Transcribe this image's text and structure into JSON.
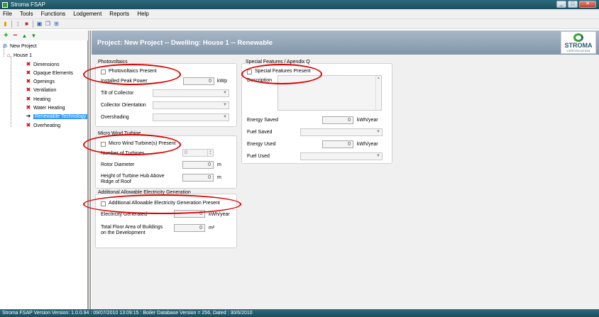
{
  "window": {
    "title": "Stroma FSAP",
    "min": "_",
    "max": "□",
    "close": "✕"
  },
  "menu": [
    "File",
    "Tools",
    "Functions",
    "Lodgement",
    "Reports",
    "Help"
  ],
  "tree": {
    "root": "New Project",
    "house": "House 1",
    "items": [
      "Dimensions",
      "Opaque Elements",
      "Openings",
      "Ventilation",
      "Heating",
      "Water Heating",
      "Renewable Technology",
      "Overheating"
    ],
    "selected_index": 6
  },
  "header": {
    "title": "Project: New Project -- Dwelling: House 1 -- Renewable"
  },
  "logo": {
    "brand": "STROMA",
    "sub": "CERTIFICATION"
  },
  "photovoltaics": {
    "legend": "Photovoltaics",
    "present_label": "Photovoltaics Present",
    "peak_power_label": "Installed Peak Power",
    "peak_power_value": "0",
    "peak_power_unit": "kWp",
    "tilt_label": "Tilt of Collector",
    "orientation_label": "Collector Orientation",
    "overshading_label": "Overshading"
  },
  "wind": {
    "legend": "Micro Wind Turbine",
    "present_label": "Micro Wind Turbine(s) Present",
    "turbines_label": "Number of Turbines",
    "turbines_value": "0",
    "rotor_label": "Rotor Diameter",
    "rotor_value": "0",
    "rotor_unit": "m",
    "hub_label_1": "Height of Turbine Hub Above",
    "hub_label_2": "Ridge of Roof",
    "hub_value": "0",
    "hub_unit": "m"
  },
  "electricity": {
    "legend": "Additional Allowable Electricity Generation",
    "present_label": "Additional Allowable Electricity Generation Present",
    "generated_label": "Electricity Generated",
    "generated_value": "0",
    "generated_unit": "kWh/year",
    "floor_label_1": "Total Floor Area of Buildings",
    "floor_label_2": "on the Development",
    "floor_value": "0",
    "floor_unit": "m²"
  },
  "special": {
    "legend": "Special Features / Apendix Q",
    "present_label": "Special Features Present",
    "description_label": "Description",
    "energy_saved_label": "Energy Saved",
    "energy_saved_value": "0",
    "energy_saved_unit": "kWh/year",
    "fuel_saved_label": "Fuel Saved",
    "energy_used_label": "Energy Used",
    "energy_used_value": "0",
    "energy_used_unit": "kWh/year",
    "fuel_used_label": "Fuel Used"
  },
  "status": {
    "text": "Stroma FSAP Version Version: 1.0.0.94  :  09/07/2010 13:09:15  :  Boiler Database Version = 256, Dated : 30/6/2010"
  },
  "colors": {
    "highlight": "#e00000",
    "header": "#8296a9",
    "selected": "#3399ff"
  }
}
